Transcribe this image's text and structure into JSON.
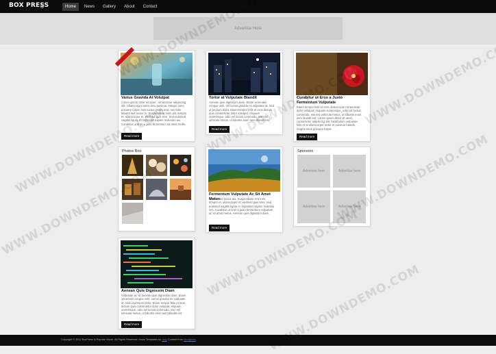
{
  "brand": {
    "logo_text": "BOX PRESS"
  },
  "nav": [
    {
      "label": "Home",
      "active": true
    },
    {
      "label": "News"
    },
    {
      "label": "Gallery"
    },
    {
      "label": "About"
    },
    {
      "label": "Contact"
    }
  ],
  "header_ad": {
    "label": "Advertise Here"
  },
  "posts": [
    {
      "badge": "",
      "title": "Varius Gravida At Volutpat",
      "excerpt": "Lorem ipsum dolor sit amet, consectetur adipiscing elit. Ullamcorper tortor arcu pulvinar. Integer nunc posuere turpis. Sed luctus ipsum erat, nec felis. Mauris sed lectus in. Suspendisse enim elit, tempor et, ullamcorper et, eleifend quis sem. Sed euismod sagittis ligula, in imperdiet sapien molestie nec. Curabitur ut eros a justo fermentum sit amet mollis",
      "readmore": "Read more"
    },
    {
      "title": "Tortor at Vulputate Blandit",
      "excerpt": "Aenean quis dignissim diam. Etiam venenatis congue velit, vel luctus gravida mi vulputate at. Sed ut pretium dolor. Etiam tempor felis et eros dictum quis consectetur dolor volutpat. Aliquam scelerisque, odio vel luctus commodo, nisi nisl vehicula metus, ut lobortis enim sem blandit est.",
      "readmore": "Read more"
    },
    {
      "title": "Curabitur ut Eros a Justo Fermentum Vulputate",
      "excerpt": "Etiam tempor felis et eros dictum quis consectetur dolor volutpat. Aliquam scelerisque, odio vel luctus commodo, nisi nisl vehicula metus, ut lobortis enim sem blandit est. Lorem ipsum dolor sit amet, consectetur adipiscing elit. Vestibulum vulputate felis et at ullamcorper tortor et pulvinar blandit, magna risus posuere turpis.",
      "readmore": "Read more"
    },
    {
      "title": "Fermentum Vulputate Ac Sit Amet Metus",
      "excerpt": "Mauris sed lectus dui. Suspendisse enim elit, tempor et, ullamcorper et, eleifend quis sem. Sed euismod sagittis ligula, in imperdiet sapien molestie nec. Curabitur ut eros a justo fermentum vulputate ac sit amet metus. Aenean quis dignissim diam.",
      "readmore": "Read more"
    },
    {
      "title": "Aenean Quis Dignissim Diam",
      "excerpt": "Vulputate ac sit aenean quis dignissim diam. Etiam venenatis congue velit, varius gravida mi vulputate at. Sed ut pretium dolor. Etiam tempor felis et eros dictum quis consectetur dolor volutpat. Aliquam scelerisque, odio vel luctus commodo, nisi nisl vehicula metus, ut lobortis enim sem blandit est.",
      "readmore": "Read more"
    }
  ],
  "photos_box": {
    "title": "Photos Box"
  },
  "sponsors": {
    "title": "Sponsors",
    "slots": [
      "Advertise here",
      "Advertise here",
      "Advertise here",
      "Advertise here"
    ]
  },
  "footer": {
    "copyright": "Copyright © 2012 BoxPress is Popular Vision. All Rights Reserved. Inove Templates",
    "by_label": "by",
    "author": "Jolly",
    "credit_label": "Content from",
    "credit_link": "Wordpress"
  },
  "watermark": {
    "text": "WWW.DOWNDEMO.COM"
  },
  "colors": {
    "topbar": "#0b0b0b",
    "readmore": "#111111",
    "ribbon": "#c4161c"
  }
}
